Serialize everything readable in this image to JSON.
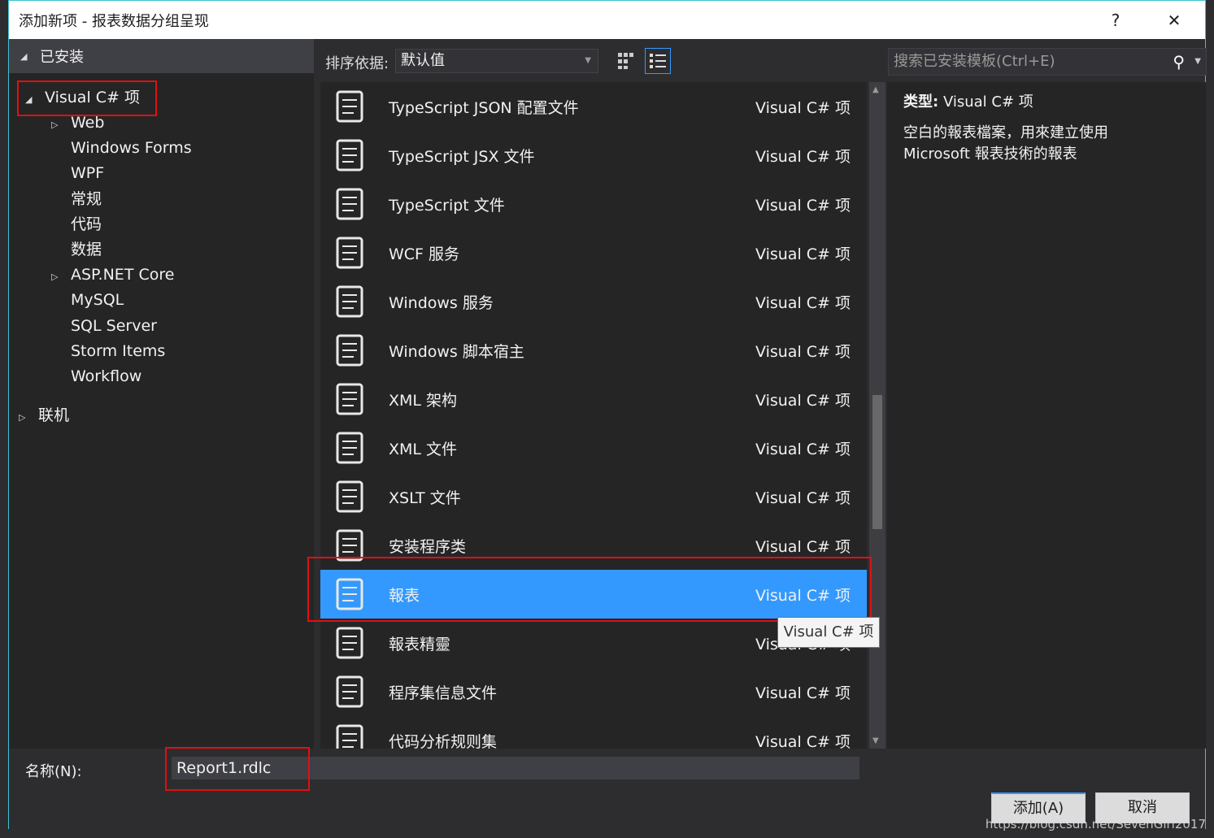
{
  "title": "添加新项 - 报表数据分组呈现",
  "title_buttons": {
    "help": "?",
    "close": "✕"
  },
  "left": {
    "header": "已安装",
    "root": "Visual C# 项",
    "children": [
      "Web",
      "Windows Forms",
      "WPF",
      "常规",
      "代码",
      "数据",
      "ASP.NET Core",
      "MySQL",
      "SQL Server",
      "Storm Items",
      "Workflow"
    ],
    "online": "联机"
  },
  "toolbar": {
    "sort_label": "排序依据:",
    "sort_value": "默认值"
  },
  "search": {
    "placeholder": "搜索已安装模板(Ctrl+E)"
  },
  "items": [
    {
      "name": "TypeScript JSON 配置文件",
      "type": "Visual C# 项",
      "icon": "json-config-icon"
    },
    {
      "name": "TypeScript JSX 文件",
      "type": "Visual C# 项",
      "icon": "ts-file-icon"
    },
    {
      "name": "TypeScript 文件",
      "type": "Visual C# 项",
      "icon": "ts-file-icon"
    },
    {
      "name": "WCF 服务",
      "type": "Visual C# 项",
      "icon": "wcf-service-icon"
    },
    {
      "name": "Windows 服务",
      "type": "Visual C# 项",
      "icon": "windows-service-icon"
    },
    {
      "name": "Windows 脚本宿主",
      "type": "Visual C# 项",
      "icon": "script-icon"
    },
    {
      "name": "XML 架构",
      "type": "Visual C# 项",
      "icon": "xml-schema-icon"
    },
    {
      "name": "XML 文件",
      "type": "Visual C# 项",
      "icon": "xml-file-icon"
    },
    {
      "name": "XSLT 文件",
      "type": "Visual C# 项",
      "icon": "xslt-icon"
    },
    {
      "name": "安装程序类",
      "type": "Visual C# 项",
      "icon": "installer-icon"
    },
    {
      "name": "報表",
      "type": "Visual C# 项",
      "icon": "report-icon",
      "selected": true
    },
    {
      "name": "報表精靈",
      "type": "Visual C# 项",
      "icon": "report-wizard-icon"
    },
    {
      "name": "程序集信息文件",
      "type": "Visual C# 项",
      "icon": "assembly-info-icon"
    },
    {
      "name": "代码分析规则集",
      "type": "Visual C# 项",
      "icon": "ruleset-icon"
    }
  ],
  "details": {
    "type_label": "类型:",
    "type_value": "Visual C# 项",
    "description": "空白的報表檔案，用來建立使用 Microsoft 報表技術的報表"
  },
  "tooltip": "Visual C# 项",
  "name_field": {
    "label": "名称(N):",
    "value": "Report1.rdlc"
  },
  "buttons": {
    "add": "添加(A)",
    "cancel": "取消"
  },
  "watermark": "https://blog.csdn.net/SevenGirl2017",
  "colors": {
    "selection": "#3399ff",
    "highlight_box": "#e01010",
    "accent": "#3fc1d1"
  }
}
